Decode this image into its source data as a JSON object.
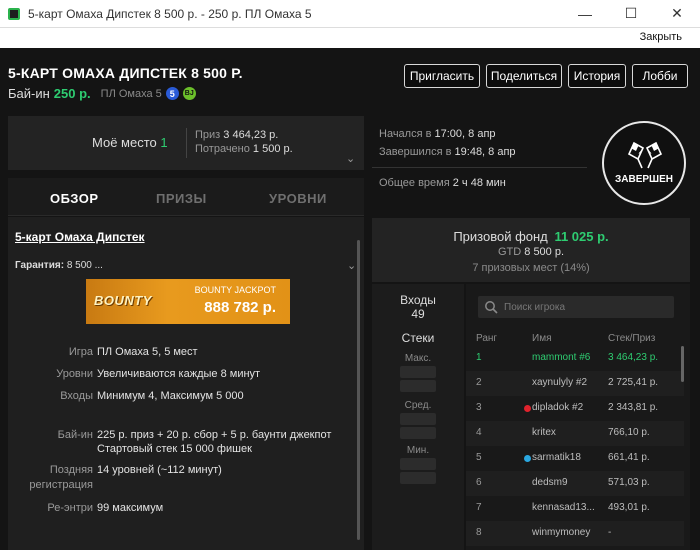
{
  "window": {
    "title": "5-карт Омаха Дипстек 8 500 р.   - 250 р. ПЛ Омаха 5",
    "close_link": "Закрыть"
  },
  "header": {
    "title": "5-КАРТ ОМАХА ДИПСТЕК 8 500 Р.",
    "buyin_label": "Бай-ин",
    "buyin_value": "250 р.",
    "game_type": "ПЛ Омаха 5",
    "badge_number": "5",
    "badge_bj": "BJ",
    "buttons": {
      "invite": "Пригласить",
      "share": "Поделиться",
      "history": "История",
      "lobby": "Лобби"
    }
  },
  "myplace": {
    "label": "Моё место",
    "value": "1",
    "prize_label": "Приз",
    "prize_value": "3 464,23 р.",
    "spent_label": "Потрачено",
    "spent_value": "1 500 р."
  },
  "tabs": {
    "overview": "ОБЗОР",
    "prizes": "ПРИЗЫ",
    "levels": "УРОВНИ"
  },
  "details": {
    "title": "5-карт Омаха Дипстек",
    "guarantee_label": "Гарантия:",
    "guarantee_value": "8 500 ...",
    "bounty_logo": "BOUNTY",
    "bounty_label": "BOUNTY JACKPOT",
    "bounty_amount": "888 782 р.",
    "rows": [
      {
        "label": "Игра",
        "value": "ПЛ Омаха 5, 5 мест"
      },
      {
        "label": "Уровни",
        "value": "Увеличиваются каждые 8 минут"
      },
      {
        "label": "Входы",
        "value": "Минимум 4, Максимум 5 000"
      },
      {
        "label": "Бай-ин",
        "value": "225 р. приз + 20 р. сбор + 5 р. баунти джекпот",
        "value2": "Стартовый стек 15 000 фишек"
      },
      {
        "label": "Поздняя",
        "label2": "регистрация",
        "value": "14 уровней (~112 минут)"
      },
      {
        "label": "Ре-энтри",
        "value": "99 максимум"
      }
    ]
  },
  "timing": {
    "started_label": "Начался в",
    "started_value": "17:00, 8 апр",
    "ended_label": "Завершился в",
    "ended_value": "19:48, 8 апр",
    "total_label": "Общее время",
    "total_value": "2 ч 48 мин"
  },
  "status": {
    "text": "ЗАВЕРШЕН"
  },
  "prizepool": {
    "label": "Призовой фонд",
    "value": "11 025 р.",
    "gtd_label": "GTD",
    "gtd_value": "8 500 р.",
    "places": "7 призовых мест (14%)"
  },
  "stats": {
    "entries_label": "Входы",
    "entries_value": "49",
    "stacks_label": "Стеки",
    "max_label": "Макс.",
    "avg_label": "Сред.",
    "min_label": "Мин."
  },
  "players": {
    "search_placeholder": "Поиск игрока",
    "col_rank": "Ранг",
    "col_name": "Имя",
    "col_stack": "Стек/Приз",
    "dot_colors": {
      "red": "#e0222c",
      "blue": "#2aa7e0"
    },
    "rows": [
      {
        "rank": "1",
        "name": "mammont #6",
        "stack": "3 464,23 р."
      },
      {
        "rank": "2",
        "name": "xaynulyly #2",
        "stack": "2 725,41 р."
      },
      {
        "rank": "3",
        "name": "dipladok #2",
        "stack": "2 343,81 р."
      },
      {
        "rank": "4",
        "name": "kritex",
        "stack": "766,10 р."
      },
      {
        "rank": "5",
        "name": "sarmatik18",
        "stack": "661,41 р."
      },
      {
        "rank": "6",
        "name": "dedsm9",
        "stack": "571,03 р."
      },
      {
        "rank": "7",
        "name": "kennasad13...",
        "stack": "493,01 р."
      },
      {
        "rank": "8",
        "name": "winmymoney",
        "stack": "-"
      }
    ]
  }
}
